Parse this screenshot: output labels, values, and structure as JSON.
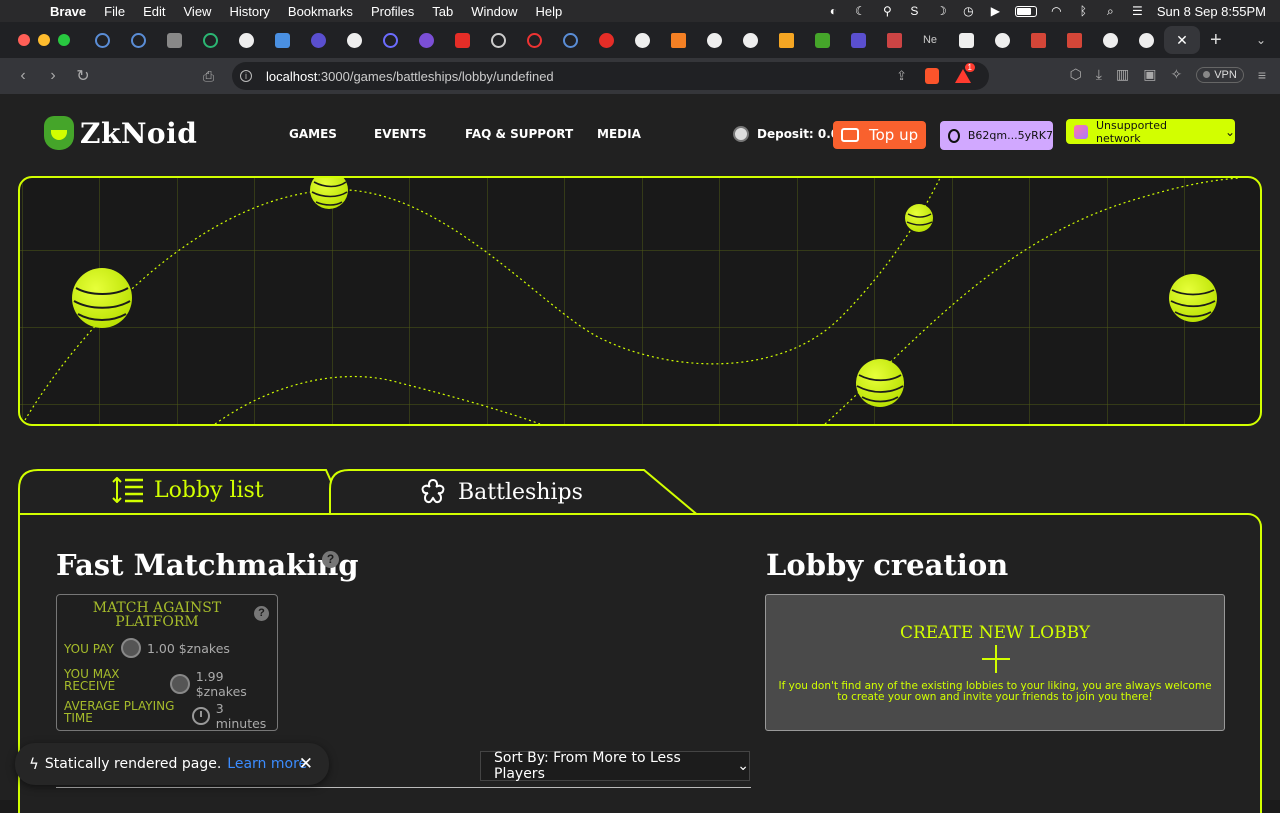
{
  "menubar": {
    "app": "Brave",
    "items": [
      "File",
      "Edit",
      "View",
      "History",
      "Bookmarks",
      "Profiles",
      "Tab",
      "Window",
      "Help"
    ],
    "datetime": "Sun 8 Sep  8:55PM"
  },
  "tabs": {
    "active_close": "✕",
    "new_tab": "+"
  },
  "address": {
    "url_host": "localhost",
    "url_path": ":3000/games/battleships/lobby/undefined",
    "shields_badge": "1",
    "vpn_label": "VPN"
  },
  "site": {
    "logo_text": "ZkNoid",
    "nav": [
      "GAMES",
      "EVENTS",
      "FAQ & SUPPORT",
      "MEDIA"
    ],
    "deposit_label": "Deposit: 0.00",
    "topup_label": "Top up",
    "account_label": "B62qm...5yRK7",
    "network_label": "Unsupported network"
  },
  "lobby": {
    "tab_lobby_list": "Lobby list",
    "tab_battleships": "Battleships",
    "fast_matchmaking_title": "Fast Matchmaking",
    "match_card": {
      "title": "MATCH AGAINST PLATFORM",
      "you_pay_label": "YOU PAY",
      "you_pay_value": "1.00 $znakes",
      "you_max_receive_label": "YOU MAX RECEIVE",
      "you_max_receive_value": "1.99 $znakes",
      "avg_time_label": "AVERAGE PLAYING TIME",
      "avg_time_value": "3 minutes"
    },
    "lobby_creation_title": "Lobby creation",
    "create_card": {
      "title": "CREATE NEW LOBBY",
      "description": "If you don't find any of the existing lobbies to your liking, you are always welcome to create your own and invite your friends to join you there!"
    },
    "sort_label": "Sort By: From More to Less Players"
  },
  "toast": {
    "text": "Statically rendered page.",
    "link": "Learn more"
  },
  "colors": {
    "accent": "#d2ff00",
    "topup": "#f9612e",
    "account": "#d1a8ff",
    "background": "#212121"
  }
}
